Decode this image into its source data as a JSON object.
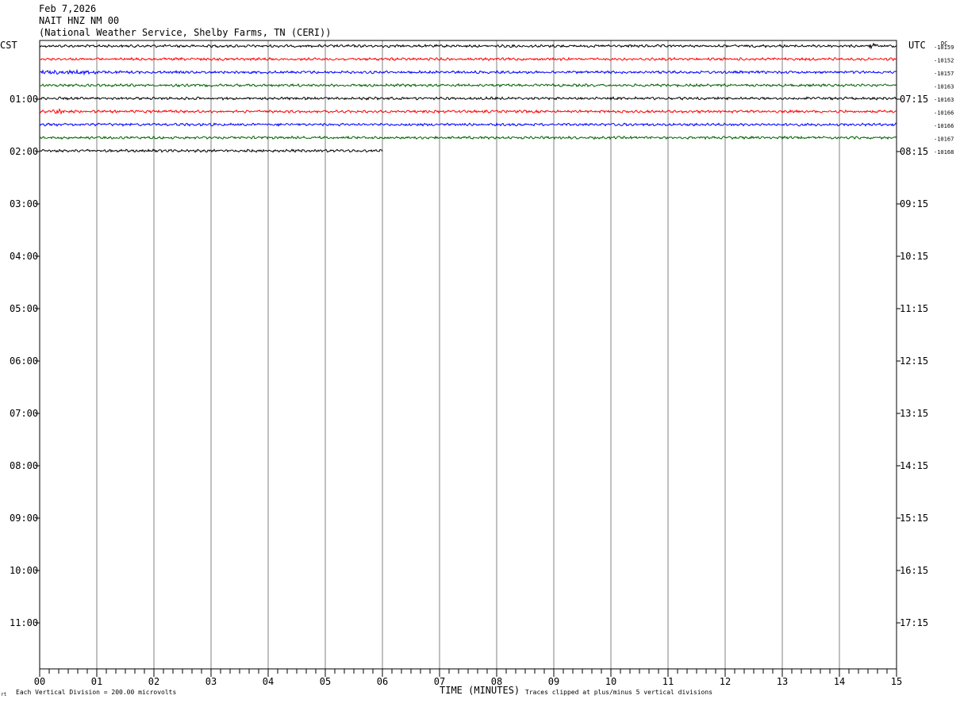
{
  "header": {
    "date": "Feb 7,2026",
    "station": "NAIT HNZ NM 00",
    "location": "(National Weather Service, Shelby Farms, TN (CERI))"
  },
  "axis": {
    "left_tz": "CST",
    "right_tz": "UTC",
    "dc_label": "DC",
    "xlabel": "TIME (MINUTES)"
  },
  "footer": {
    "corner_mark": "rt",
    "scale_note": "Each Vertical Division =  200.00 microvolts",
    "clip_note": "Traces clipped at plus/minus 5 vertical divisions"
  },
  "colors": {
    "trace_colors": [
      "#000000",
      "#ff0000",
      "#0000ff",
      "#006400"
    ],
    "grid": "#808080"
  },
  "chart_data": {
    "type": "line",
    "title": "NAIT HNZ NM 00",
    "xlabel": "TIME (MINUTES)",
    "xlim": [
      0,
      15
    ],
    "x_ticks": [
      "00",
      "01",
      "02",
      "03",
      "04",
      "05",
      "06",
      "07",
      "08",
      "09",
      "10",
      "11",
      "12",
      "13",
      "14",
      "15"
    ],
    "left_hour_labels": [
      "01:00",
      "02:00",
      "03:00",
      "04:00",
      "05:00",
      "06:00",
      "07:00",
      "08:00",
      "09:00",
      "10:00",
      "11:00"
    ],
    "right_hour_labels": [
      "07:15",
      "08:15",
      "09:15",
      "10:15",
      "11:15",
      "12:15",
      "13:15",
      "14:15",
      "15:15",
      "16:15",
      "17:15"
    ],
    "traces": [
      {
        "color": "black",
        "dc": "-10159",
        "end_minute": 15
      },
      {
        "color": "red",
        "dc": "-10152",
        "end_minute": 15
      },
      {
        "color": "blue",
        "dc": "-10157",
        "end_minute": 15
      },
      {
        "color": "green",
        "dc": "-10163",
        "end_minute": 15
      },
      {
        "color": "black",
        "dc": "-10163",
        "end_minute": 15
      },
      {
        "color": "red",
        "dc": "-10166",
        "end_minute": 15
      },
      {
        "color": "blue",
        "dc": "-10166",
        "end_minute": 15
      },
      {
        "color": "green",
        "dc": "-10167",
        "end_minute": 15
      },
      {
        "color": "black",
        "dc": "-10168",
        "end_minute": 6
      }
    ]
  }
}
